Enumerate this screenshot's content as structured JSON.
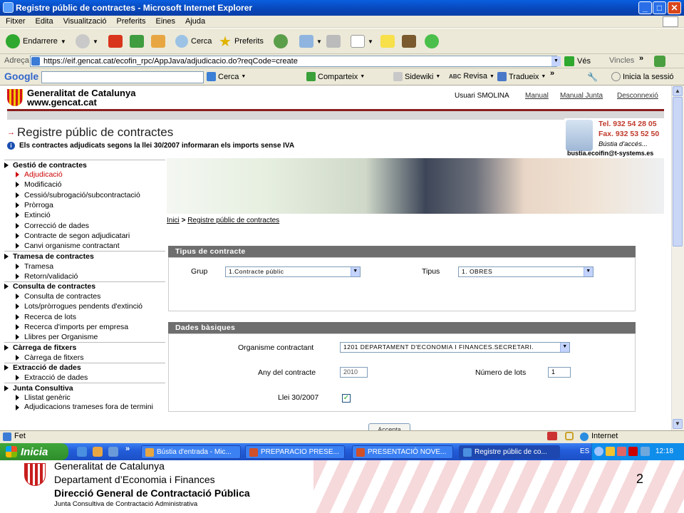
{
  "window": {
    "title": "Registre públic de contractes - Microsoft Internet Explorer",
    "min": "_",
    "max": "□",
    "close": "✕"
  },
  "menu": [
    "Fitxer",
    "Edita",
    "Visualització",
    "Preferits",
    "Eines",
    "Ajuda"
  ],
  "toolbar": {
    "back": "Endarrere",
    "search": "Cerca",
    "favorites": "Preferits"
  },
  "address": {
    "label": "Adreça",
    "url": "https://eif.gencat.cat/ecofin_rpc/AppJava/adjudicacio.do?reqCode=create",
    "go": "Vés",
    "links": "Vincles"
  },
  "googlebar": {
    "logo": "Google",
    "search": "Cerca",
    "share": "Comparteix",
    "sidewiki": "Sidewiki",
    "check": "Revisa",
    "translate": "Tradueix",
    "signin": "Inicia la sessió"
  },
  "header": {
    "brand1": "Generalitat de Catalunya",
    "brand2": "www.gencat.cat",
    "user": "Usuari SMOLINA",
    "manual": "Manual",
    "manual_junta": "Manual Junta",
    "logout": "Desconnexió"
  },
  "page": {
    "title": "Registre públic de contractes",
    "info": "Els contractes adjudicats segons la llei 30/2007 informaran els imports sense IVA"
  },
  "contact": {
    "tel": "Tel. 932 54 28 05",
    "fax": "Fax. 932 53 52 50",
    "bustia": "Bústia d'accés...",
    "email": "bustia.ecoifin@t-systems.es"
  },
  "nav": [
    {
      "section": "Gestió de contractes",
      "items": [
        "Adjudicació",
        "Modificació",
        "Cessió/subrogació/subcontractació",
        "Pròrroga",
        "Extinció",
        "Correcció de dades",
        "Contracte de segon adjudicatari",
        "Canvi organisme contractant"
      ]
    },
    {
      "section": "Tramesa de contractes",
      "items": [
        "Tramesa",
        "Retorn/validació"
      ]
    },
    {
      "section": "Consulta de contractes",
      "items": [
        "Consulta de contractes",
        "Lots/pròrrogues pendents d'extinció",
        "Recerca de lots",
        "Recerca d'imports per empresa",
        "Llibres per Organisme"
      ]
    },
    {
      "section": "Càrrega de fitxers",
      "items": [
        "Càrrega de fitxers"
      ]
    },
    {
      "section": "Extracció de dades",
      "items": [
        "Extracció de dades"
      ]
    },
    {
      "section": "Junta Consultiva",
      "items": [
        "Llistat genèric",
        "Adjudicacions trameses fora de termini"
      ]
    }
  ],
  "breadcrumb": {
    "home": "Inici",
    "sep": ">",
    "current": "Registre públic de contractes"
  },
  "tipus_panel": {
    "title": "Tipus de contracte",
    "grup_label": "Grup",
    "grup_value": "1.Contracte públic",
    "tipus_label": "Tipus",
    "tipus_value": "1. OBRES"
  },
  "dades_panel": {
    "title": "Dades bàsiques",
    "org_label": "Organisme contractant",
    "org_value": "1201 DEPARTAMENT D'ECONOMIA I FINANCES.SECRETARI.",
    "any_label": "Any del contracte",
    "any_value": "2010",
    "lots_label": "Número de lots",
    "lots_value": "1",
    "llei_label": "Llei 30/2007",
    "llei_checked": true,
    "button": "Accepta"
  },
  "status": {
    "text": "Fet",
    "zone": "Internet"
  },
  "taskbar": {
    "start": "Inicia",
    "tasks": [
      "Bústia d'entrada - Mic...",
      "PREPARACIO PRESE...",
      "PRESENTACIÓ NOVE...",
      "Registre públic de co..."
    ],
    "lang": "ES",
    "time": "12:18"
  },
  "slide": {
    "line1": "Generalitat de Catalunya",
    "line2": "Departament d’Economia i Finances",
    "line3": "Direcció General de Contractació Pública",
    "line4": "Junta Consultiva de Contractació Administrativa",
    "page": "2"
  },
  "colors": {
    "titlebar": "#0a5fe0",
    "header_red": "#8b1e1e",
    "panel_head": "#6e6e6e",
    "active_nav": "#cc0000"
  }
}
